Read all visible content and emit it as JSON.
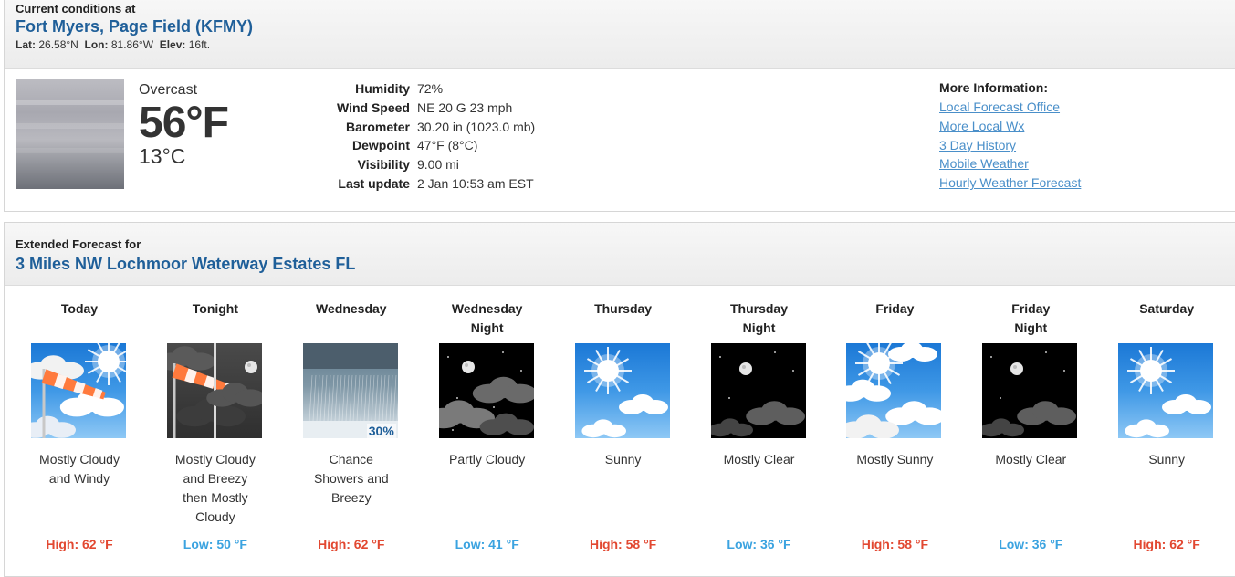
{
  "current": {
    "label": "Current conditions at",
    "station": "Fort Myers, Page Field (KFMY)",
    "lat_label": "Lat:",
    "lat": "26.58°N",
    "lon_label": "Lon:",
    "lon": "81.86°W",
    "elev_label": "Elev:",
    "elev": "16ft.",
    "condition": "Overcast",
    "temp_f": "56°F",
    "temp_c": "13°C",
    "details": [
      {
        "key": "Humidity",
        "value": "72%"
      },
      {
        "key": "Wind Speed",
        "value": "NE 20 G 23 mph"
      },
      {
        "key": "Barometer",
        "value": "30.20 in (1023.0 mb)"
      },
      {
        "key": "Dewpoint",
        "value": "47°F (8°C)"
      },
      {
        "key": "Visibility",
        "value": "9.00 mi"
      },
      {
        "key": "Last update",
        "value": "2 Jan 10:53 am EST"
      }
    ],
    "more_info": {
      "title": "More Information:",
      "links": [
        "Local Forecast Office",
        "More Local Wx",
        "3 Day History",
        "Mobile Weather",
        "Hourly Weather Forecast"
      ]
    }
  },
  "extended": {
    "label": "Extended Forecast for",
    "location": "3 Miles NW Lochmoor Waterway Estates FL",
    "days": [
      {
        "name": "Today",
        "desc": "Mostly Cloudy and Windy",
        "temp": "High: 62 °F",
        "kind": "high",
        "icon": "windy-cloudy-icon"
      },
      {
        "name": "Tonight",
        "desc": "Mostly Cloudy and Breezy then Mostly Cloudy",
        "temp": "Low: 50 °F",
        "kind": "low",
        "icon": "breezy-night-icon"
      },
      {
        "name": "Wednesday",
        "desc": "Chance Showers and Breezy",
        "temp": "High: 62 °F",
        "kind": "high",
        "icon": "showers-icon",
        "precip": "30%"
      },
      {
        "name": "Wednesday Night",
        "desc": "Partly Cloudy",
        "temp": "Low: 41 °F",
        "kind": "low",
        "icon": "partly-cloudy-night-icon"
      },
      {
        "name": "Thursday",
        "desc": "Sunny",
        "temp": "High: 58 °F",
        "kind": "high",
        "icon": "sunny-icon"
      },
      {
        "name": "Thursday Night",
        "desc": "Mostly Clear",
        "temp": "Low: 36 °F",
        "kind": "low",
        "icon": "clear-night-icon"
      },
      {
        "name": "Friday",
        "desc": "Mostly Sunny",
        "temp": "High: 58 °F",
        "kind": "high",
        "icon": "mostly-sunny-icon"
      },
      {
        "name": "Friday Night",
        "desc": "Mostly Clear",
        "temp": "Low: 36 °F",
        "kind": "low",
        "icon": "clear-night-icon"
      },
      {
        "name": "Saturday",
        "desc": "Sunny",
        "temp": "High: 62 °F",
        "kind": "high",
        "icon": "sunny-icon"
      }
    ]
  },
  "colors": {
    "title": "#1f5f99",
    "link": "#4a8fc9",
    "high": "#e24831",
    "low": "#3ba3e0"
  }
}
